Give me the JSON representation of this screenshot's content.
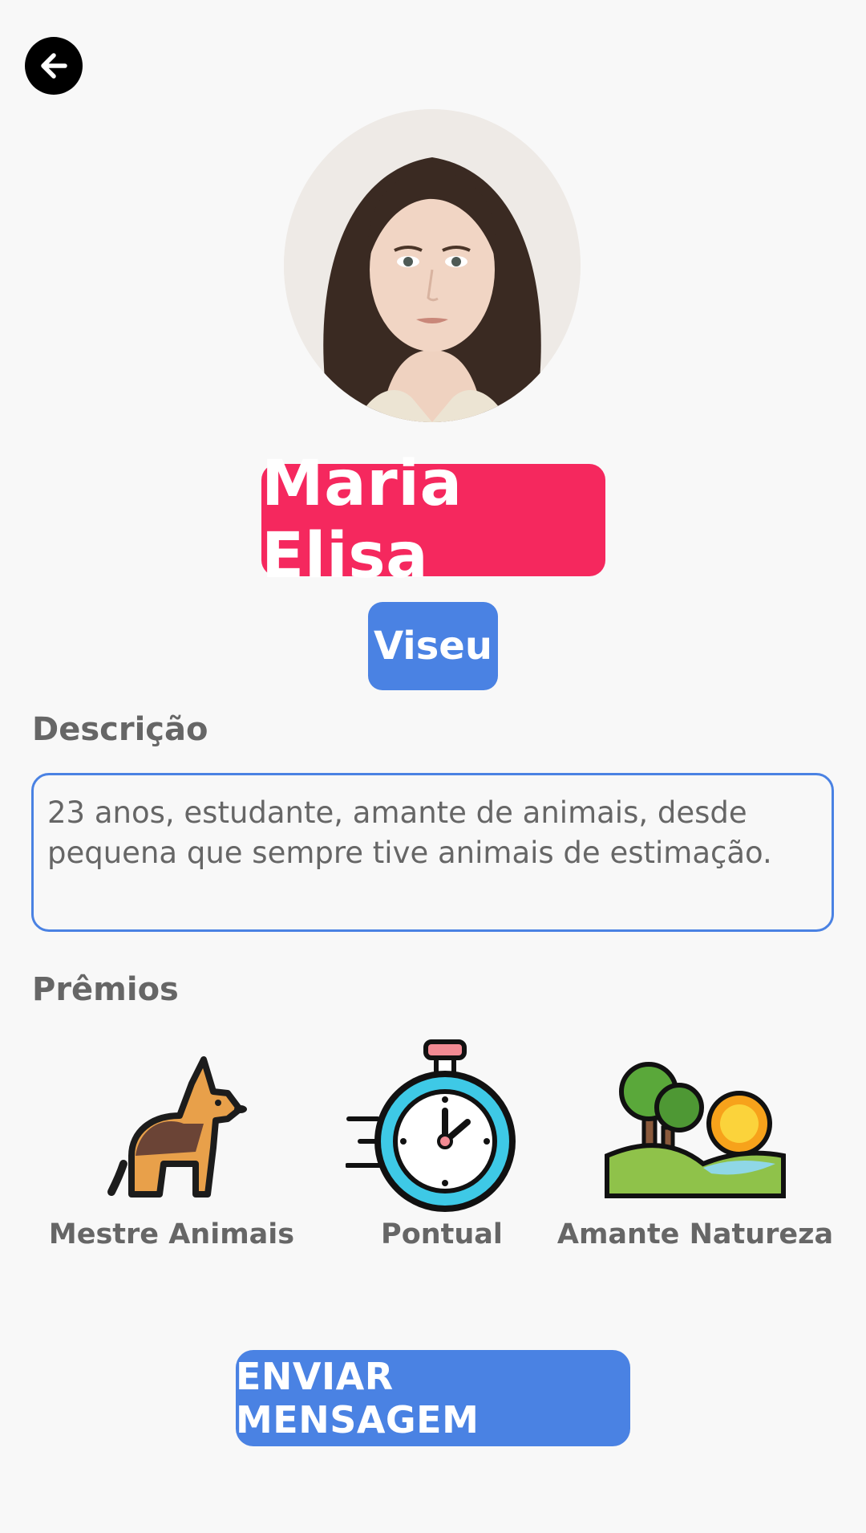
{
  "profile": {
    "name": "Maria Elisa",
    "city": "Viseu",
    "description_label": "Descrição",
    "description": "23 anos, estudante, amante de animais, desde pequena que sempre tive animais de estimação."
  },
  "awards": {
    "label": "Prêmios",
    "items": [
      {
        "label": "Mestre Animais",
        "icon": "dog-icon"
      },
      {
        "label": "Pontual",
        "icon": "stopwatch-icon"
      },
      {
        "label": "Amante Natureza",
        "icon": "nature-landscape-icon"
      }
    ]
  },
  "actions": {
    "send_message": "ENVIAR MENSAGEM",
    "back_icon": "arrow-left-icon"
  },
  "colors": {
    "name_badge": "#f5285e",
    "accent_blue": "#4a82e3",
    "background": "#f8f8f8",
    "muted_text": "#666666"
  }
}
